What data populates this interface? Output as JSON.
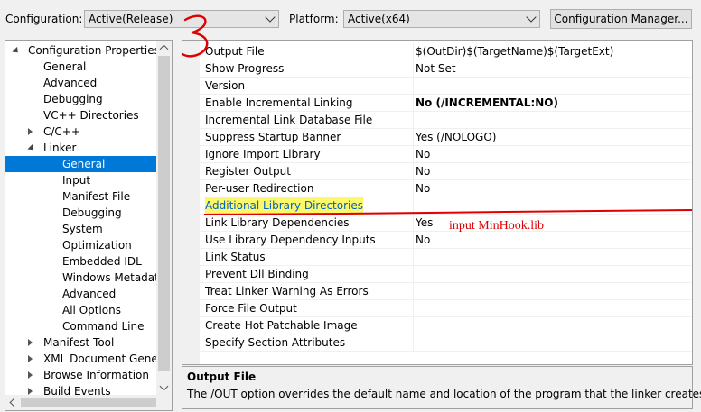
{
  "top": {
    "configuration_label": "Configuration:",
    "configuration_value": "Active(Release)",
    "platform_label": "Platform:",
    "platform_value": "Active(x64)",
    "config_manager_button": "Configuration Manager..."
  },
  "tree": [
    {
      "label": "Configuration Properties",
      "indent": 0,
      "expander": "open",
      "selected": false
    },
    {
      "label": "General",
      "indent": 1,
      "expander": "none",
      "selected": false
    },
    {
      "label": "Advanced",
      "indent": 1,
      "expander": "none",
      "selected": false
    },
    {
      "label": "Debugging",
      "indent": 1,
      "expander": "none",
      "selected": false
    },
    {
      "label": "VC++ Directories",
      "indent": 1,
      "expander": "none",
      "selected": false
    },
    {
      "label": "C/C++",
      "indent": 1,
      "expander": "closed",
      "selected": false
    },
    {
      "label": "Linker",
      "indent": 1,
      "expander": "open",
      "selected": false
    },
    {
      "label": "General",
      "indent": 2,
      "expander": "none",
      "selected": true
    },
    {
      "label": "Input",
      "indent": 2,
      "expander": "none",
      "selected": false
    },
    {
      "label": "Manifest File",
      "indent": 2,
      "expander": "none",
      "selected": false
    },
    {
      "label": "Debugging",
      "indent": 2,
      "expander": "none",
      "selected": false
    },
    {
      "label": "System",
      "indent": 2,
      "expander": "none",
      "selected": false
    },
    {
      "label": "Optimization",
      "indent": 2,
      "expander": "none",
      "selected": false
    },
    {
      "label": "Embedded IDL",
      "indent": 2,
      "expander": "none",
      "selected": false
    },
    {
      "label": "Windows Metadata",
      "indent": 2,
      "expander": "none",
      "selected": false
    },
    {
      "label": "Advanced",
      "indent": 2,
      "expander": "none",
      "selected": false
    },
    {
      "label": "All Options",
      "indent": 2,
      "expander": "none",
      "selected": false
    },
    {
      "label": "Command Line",
      "indent": 2,
      "expander": "none",
      "selected": false
    },
    {
      "label": "Manifest Tool",
      "indent": 1,
      "expander": "closed",
      "selected": false
    },
    {
      "label": "XML Document Generator",
      "indent": 1,
      "expander": "closed",
      "selected": false
    },
    {
      "label": "Browse Information",
      "indent": 1,
      "expander": "closed",
      "selected": false
    },
    {
      "label": "Build Events",
      "indent": 1,
      "expander": "closed",
      "selected": false
    }
  ],
  "properties": [
    {
      "name": "Output File",
      "value": "$(OutDir)$(TargetName)$(TargetExt)",
      "bold": false,
      "highlight": false
    },
    {
      "name": "Show Progress",
      "value": "Not Set",
      "bold": false,
      "highlight": false
    },
    {
      "name": "Version",
      "value": "",
      "bold": false,
      "highlight": false
    },
    {
      "name": "Enable Incremental Linking",
      "value": "No (/INCREMENTAL:NO)",
      "bold": true,
      "highlight": false
    },
    {
      "name": "Incremental Link Database File",
      "value": "",
      "bold": false,
      "highlight": false
    },
    {
      "name": "Suppress Startup Banner",
      "value": "Yes (/NOLOGO)",
      "bold": false,
      "highlight": false
    },
    {
      "name": "Ignore Import Library",
      "value": "No",
      "bold": false,
      "highlight": false
    },
    {
      "name": "Register Output",
      "value": "No",
      "bold": false,
      "highlight": false
    },
    {
      "name": "Per-user Redirection",
      "value": "No",
      "bold": false,
      "highlight": false
    },
    {
      "name": "Additional Library Directories",
      "value": "",
      "bold": false,
      "highlight": true
    },
    {
      "name": "Link Library Dependencies",
      "value": "Yes",
      "bold": false,
      "highlight": false
    },
    {
      "name": "Use Library Dependency Inputs",
      "value": "No",
      "bold": false,
      "highlight": false
    },
    {
      "name": "Link Status",
      "value": "",
      "bold": false,
      "highlight": false
    },
    {
      "name": "Prevent Dll Binding",
      "value": "",
      "bold": false,
      "highlight": false
    },
    {
      "name": "Treat Linker Warning As Errors",
      "value": "",
      "bold": false,
      "highlight": false
    },
    {
      "name": "Force File Output",
      "value": "",
      "bold": false,
      "highlight": false
    },
    {
      "name": "Create Hot Patchable Image",
      "value": "",
      "bold": false,
      "highlight": false
    },
    {
      "name": "Specify Section Attributes",
      "value": "",
      "bold": false,
      "highlight": false
    }
  ],
  "description": {
    "title": "Output File",
    "body": "The /OUT option overrides the default name and location of the program that the linker creates."
  },
  "annotations": {
    "number": "3",
    "note": "input MinHook.lib",
    "color": "#e00000"
  },
  "colors": {
    "selection": "#0078d7",
    "highlight": "#fbf86b"
  }
}
